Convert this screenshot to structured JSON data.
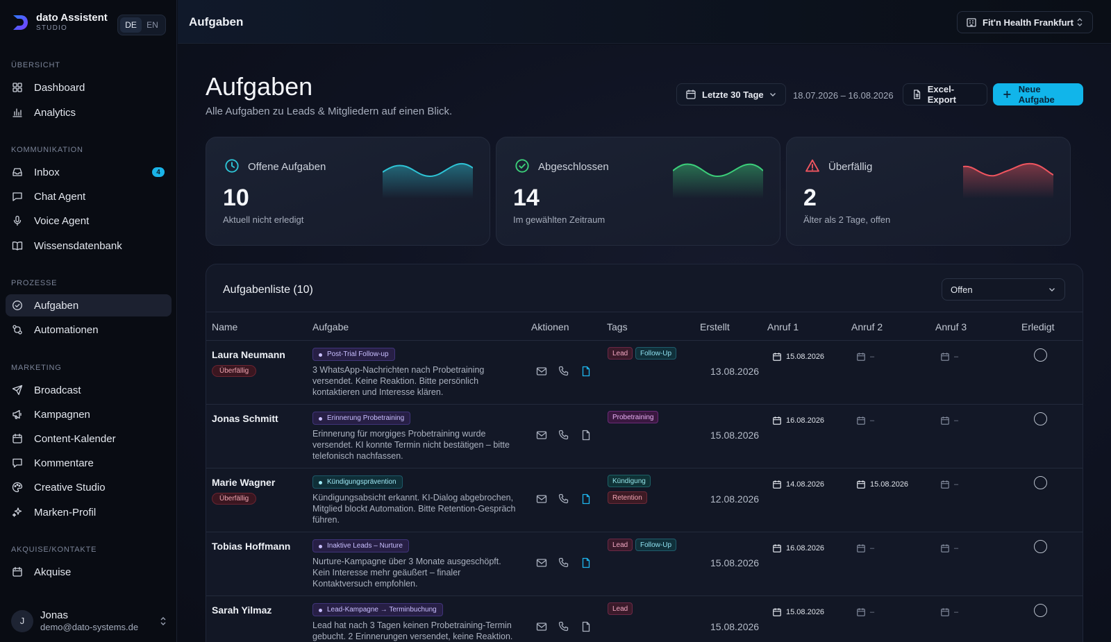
{
  "brand": {
    "name": "dato Assistent",
    "sub": "STUDIO",
    "lang": [
      "DE",
      "EN"
    ],
    "lang_active": "DE"
  },
  "sidebar": {
    "sections": [
      {
        "title": "ÜBERSICHT",
        "items": [
          {
            "label": "Dashboard",
            "icon": "dashboard-icon"
          },
          {
            "label": "Analytics",
            "icon": "analytics-icon"
          }
        ]
      },
      {
        "title": "KOMMUNIKATION",
        "items": [
          {
            "label": "Inbox",
            "icon": "inbox-icon",
            "badge": "4"
          },
          {
            "label": "Chat Agent",
            "icon": "chat-icon"
          },
          {
            "label": "Voice Agent",
            "icon": "mic-icon"
          },
          {
            "label": "Wissensdatenbank",
            "icon": "book-icon"
          }
        ]
      },
      {
        "title": "PROZESSE",
        "items": [
          {
            "label": "Aufgaben",
            "icon": "check-circle-icon",
            "active": true
          },
          {
            "label": "Automationen",
            "icon": "workflow-icon"
          }
        ]
      },
      {
        "title": "MARKETING",
        "items": [
          {
            "label": "Broadcast",
            "icon": "send-icon"
          },
          {
            "label": "Kampagnen",
            "icon": "megaphone-icon"
          },
          {
            "label": "Content-Kalender",
            "icon": "calendar-icon"
          },
          {
            "label": "Kommentare",
            "icon": "comment-icon"
          },
          {
            "label": "Creative Studio",
            "icon": "palette-icon"
          },
          {
            "label": "Marken-Profil",
            "icon": "sparkles-icon"
          }
        ]
      },
      {
        "title": "AKQUISE/KONTAKTE",
        "items": [
          {
            "label": "Akquise",
            "icon": "calendar-icon"
          }
        ]
      }
    ],
    "user": {
      "initial": "J",
      "name": "Jonas",
      "email": "demo@dato-systems.de"
    }
  },
  "topbar": {
    "title": "Aufgaben",
    "location": "Fit'n Health Frankfurt"
  },
  "page": {
    "title": "Aufgaben",
    "subtitle": "Alle Aufgaben zu Leads & Mitgliedern auf einen Blick.",
    "date_filter": "Letzte 30 Tage",
    "date_range": "18.07.2026 – 16.08.2026",
    "export_label": "Excel-Export",
    "new_label": "Neue Aufgabe"
  },
  "kpis": [
    {
      "label": "Offene Aufgaben",
      "value": "10",
      "sub": "Aktuell nicht erledigt",
      "color": "#2ec4d6",
      "icon": "clock-icon"
    },
    {
      "label": "Abgeschlossen",
      "value": "14",
      "sub": "Im gewählten Zeitraum",
      "color": "#3ccf7a",
      "icon": "check-circle-icon"
    },
    {
      "label": "Überfällig",
      "value": "2",
      "sub": "Älter als 2 Tage, offen",
      "color": "#f0555f",
      "icon": "alert-triangle-icon"
    }
  ],
  "list": {
    "title": "Aufgabenliste (10)",
    "filter": "Offen",
    "columns": [
      "Name",
      "Aufgabe",
      "Aktionen",
      "Tags",
      "Erstellt",
      "Anruf 1",
      "Anruf 2",
      "Anruf 3",
      "Erledigt"
    ],
    "rows": [
      {
        "name": "Laura Neumann",
        "overdue": "Überfällig",
        "task": "Post-Trial Follow-up",
        "task_color": "violet",
        "desc": "3 WhatsApp-Nachrichten nach Probetraining versendet. Keine Reaktion. Bitte persönlich kontaktieren und Interesse klären.",
        "tags": [
          "Lead",
          "Follow-Up"
        ],
        "created": "13.08.2026",
        "call1": "15.08.2026",
        "call2": "–",
        "call3": "–",
        "doc_active": true
      },
      {
        "name": "Jonas Schmitt",
        "overdue": "",
        "task": "Erinnerung Probetraining",
        "task_color": "violet",
        "desc": "Erinnerung für morgiges Probetraining wurde versendet. KI konnte Termin nicht bestätigen – bitte telefonisch nachfassen.",
        "tags": [
          "Probetraining"
        ],
        "created": "15.08.2026",
        "call1": "16.08.2026",
        "call2": "–",
        "call3": "–",
        "doc_active": false
      },
      {
        "name": "Marie Wagner",
        "overdue": "Überfällig",
        "task": "Kündigungsprävention",
        "task_color": "teal",
        "desc": "Kündigungsabsicht erkannt. KI-Dialog abgebrochen, Mitglied blockt Automation. Bitte Retention-Gespräch führen.",
        "tags": [
          "Kündigung",
          "Retention"
        ],
        "created": "12.08.2026",
        "call1": "14.08.2026",
        "call2": "15.08.2026",
        "call3": "–",
        "doc_active": true
      },
      {
        "name": "Tobias Hoffmann",
        "overdue": "",
        "task": "Inaktive Leads – Nurture",
        "task_color": "violet",
        "desc": "Nurture-Kampagne über 3 Monate ausgeschöpft. Kein Interesse mehr geäußert – finaler Kontaktversuch empfohlen.",
        "tags": [
          "Lead",
          "Follow-Up"
        ],
        "created": "15.08.2026",
        "call1": "16.08.2026",
        "call2": "–",
        "call3": "–",
        "doc_active": true
      },
      {
        "name": "Sarah Yilmaz",
        "overdue": "",
        "task": "Lead-Kampagne → Terminbuchung",
        "task_color": "violet",
        "desc": "Lead hat nach 3 Tagen keinen Probetraining-Termin gebucht. 2 Erinnerungen versendet, keine Reaktion.",
        "tags": [
          "Lead"
        ],
        "created": "15.08.2026",
        "call1": "15.08.2026",
        "call2": "–",
        "call3": "–",
        "doc_active": false
      }
    ]
  }
}
